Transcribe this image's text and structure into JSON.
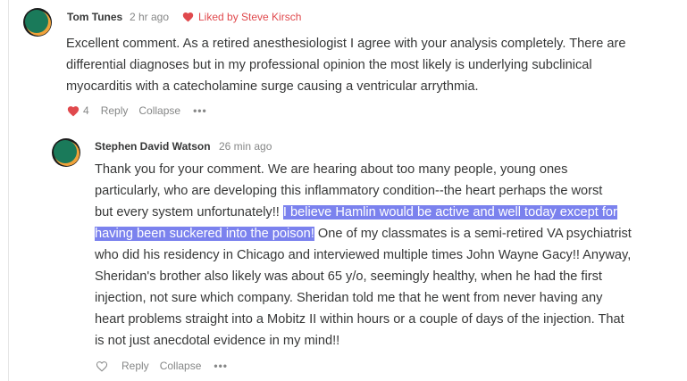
{
  "comment1": {
    "author": "Tom Tunes",
    "time": "2 hr ago",
    "liked_by": "Liked by Steve Kirsch",
    "body_lines": [
      "Excellent comment. As a retired anesthesiologist I agree with your analysis completely. There are",
      "differential diagnoses but in my professional opinion the most likely is underlying subclinical",
      "myocarditis with a catecholamine surge causing a ventricular arrythmia."
    ],
    "like_count": "4",
    "reply_label": "Reply",
    "collapse_label": "Collapse",
    "more_label": "•••",
    "liked": true
  },
  "comment2": {
    "author": "Stephen David Watson",
    "time": "26 min ago",
    "body_lines": {
      "l1": "Thank you for your comment. We are hearing about too many people, young ones",
      "l2": "particularly, who are developing this inflammatory condition--the heart perhaps the worst",
      "l3a": "but every system unfortunately!! ",
      "l3b": "I believe Hamlin would be active and well today except for",
      "l4a": "having been suckered into the poison!",
      "l4b": " One of my classmates is a semi-retired VA psychiatrist",
      "l5": "who did his residency in Chicago and interviewed multiple times John Wayne Gacy!! Anyway,",
      "l6": "Sheridan's brother also likely was about 65 y/o, seemingly healthy, when he had the first",
      "l7": "injection, not sure which company. Sheridan told me that he went from never having any",
      "l8": "heart problems straight into a Mobitz II within hours or a couple of days of the injection. That",
      "l9": "is not just anecdotal evidence in my mind!!"
    },
    "reply_label": "Reply",
    "collapse_label": "Collapse",
    "more_label": "•••",
    "liked": false
  },
  "colors": {
    "highlight": "#7b82ee",
    "like_red": "#e0494d",
    "avatar_green": "#1a7a5a",
    "avatar_orange": "#f0a23a",
    "avatar_dark": "#1c1c1c"
  }
}
